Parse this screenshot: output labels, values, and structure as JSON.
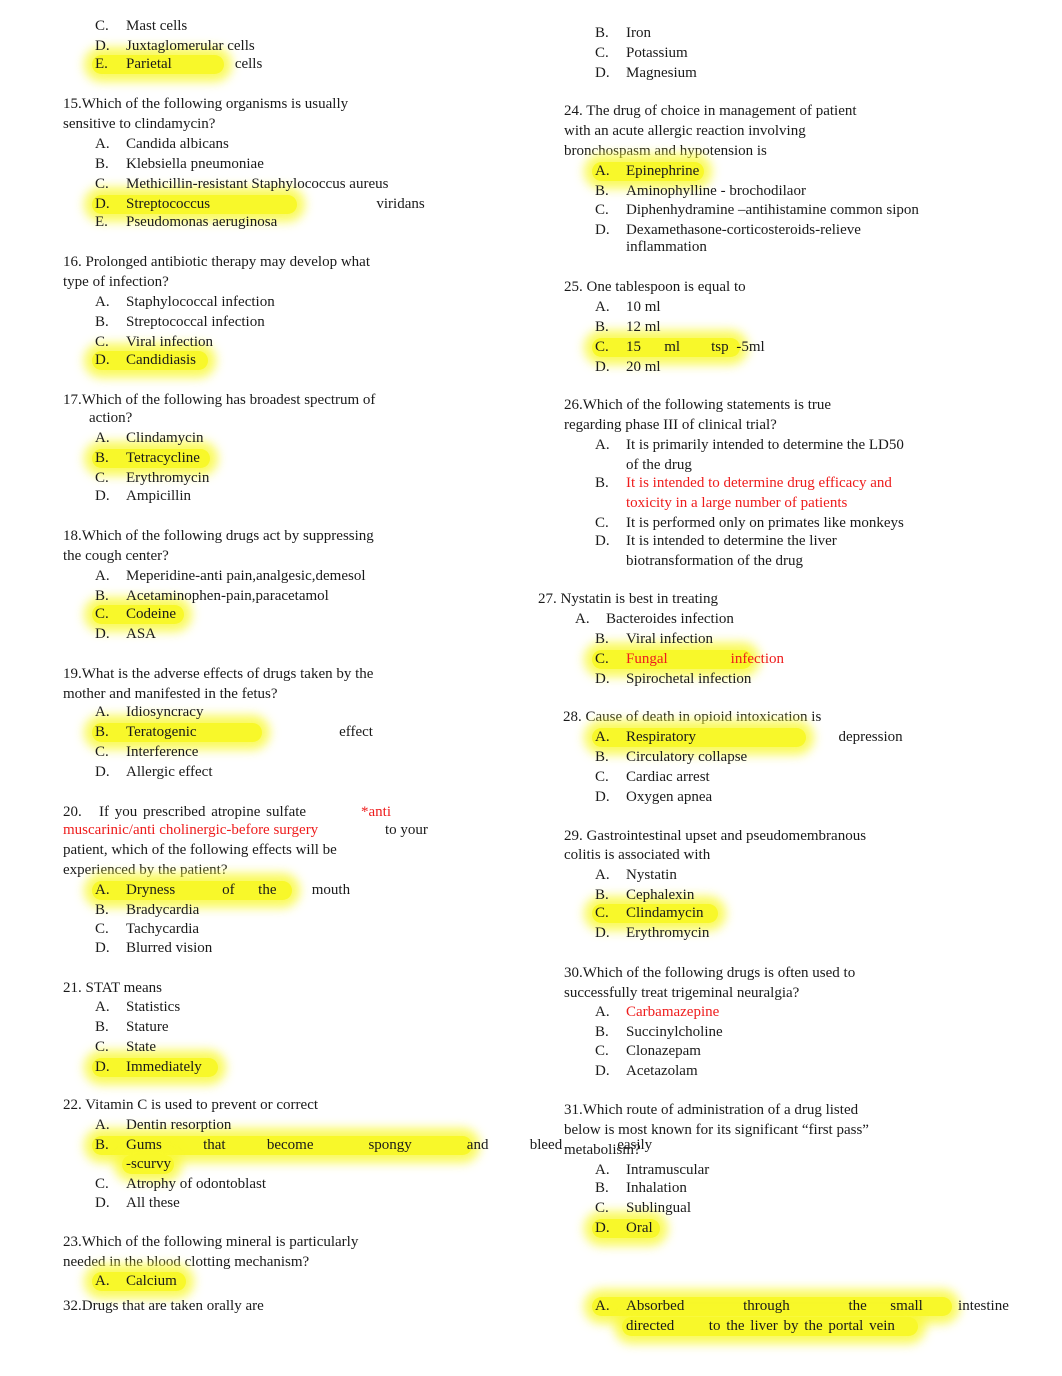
{
  "colors": {
    "highlight": "#f8f82a",
    "answer_red": "#ee1c1c",
    "text": "#1a1a1a"
  },
  "left": {
    "q14_tail": {
      "options": [
        {
          "letter": "C.",
          "text": "Mast cells"
        },
        {
          "letter": "D.",
          "text": "Juxtaglomerular cells"
        },
        {
          "letter": "E.",
          "text": "Parietal    cells",
          "highlighted": true
        }
      ]
    },
    "q15": {
      "question": [
        "15.Which of the following organisms is usually",
        "sensitive to clindamycin?"
      ],
      "options": [
        {
          "letter": "A.",
          "text": "Candida albicans"
        },
        {
          "letter": "B.",
          "text": "Klebsiella pneumoniae"
        },
        {
          "letter": "C.",
          "text": "Methicillin-resistant Staphylococcus aureus"
        },
        {
          "letter": "D.",
          "text": "Streptococcus       viridans",
          "highlighted": true
        },
        {
          "letter": "E.",
          "text": "Pseudomonas aeruginosa"
        }
      ]
    },
    "q16": {
      "question": [
        "16. Prolonged antibiotic therapy may develop what",
        "type of infection?"
      ],
      "options": [
        {
          "letter": "A.",
          "text": "Staphylococcal infection"
        },
        {
          "letter": "B.",
          "text": "Streptococcal infection"
        },
        {
          "letter": "C.",
          "text": "Viral infection"
        },
        {
          "letter": "D.",
          "text": "Candidiasis",
          "highlighted": true
        }
      ]
    },
    "q17": {
      "question": [
        "17.Which of the following has broadest spectrum of",
        "action?"
      ],
      "options": [
        {
          "letter": "A.",
          "text": "Clindamycin"
        },
        {
          "letter": "B.",
          "text": "Tetracycline",
          "highlighted": true
        },
        {
          "letter": "C.",
          "text": "Erythromycin"
        },
        {
          "letter": "D.",
          "text": "Ampicillin"
        }
      ]
    },
    "q18": {
      "question": [
        "18.Which of the following drugs act by suppressing",
        "the cough center?"
      ],
      "options": [
        {
          "letter": "A.",
          "text": "Meperidine-anti pain,analgesic,demesol"
        },
        {
          "letter": "B.",
          "text": "Acetaminophen-pain,paracetamol"
        },
        {
          "letter": "C.",
          "text": "Codeine",
          "highlighted": true
        },
        {
          "letter": "D.",
          "text": "ASA"
        }
      ]
    },
    "q19": {
      "question": [
        "19.What is the adverse effects of drugs taken by the",
        "mother and manifested in the fetus?"
      ],
      "options": [
        {
          "letter": "A.",
          "text": "Idiosyncracy"
        },
        {
          "letter": "B.",
          "text": "Teratogenic      effect",
          "highlighted": true
        },
        {
          "letter": "C.",
          "text": "Interference"
        },
        {
          "letter": "D.",
          "text": "Allergic effect"
        }
      ]
    },
    "q20": {
      "question_start": "20.   If you prescribed atropine sulfate",
      "note_1": "*anti",
      "note_2": "muscarinic/anti cholinergic-before surgery",
      "question_cont": "to your",
      "question_rest": [
        "patient, which of the following effects will be",
        "experienced by the patient?"
      ],
      "options": [
        {
          "letter": "A.",
          "text": "Dryness    of  the   mouth",
          "highlighted": true
        },
        {
          "letter": "B.",
          "text": "Bradycardia"
        },
        {
          "letter": "C.",
          "text": "Tachycardia"
        },
        {
          "letter": "D.",
          "text": "Blurred vision"
        }
      ]
    },
    "q21": {
      "question": [
        "21. STAT means"
      ],
      "options": [
        {
          "letter": "A.",
          "text": "Statistics"
        },
        {
          "letter": "B.",
          "text": "Stature"
        },
        {
          "letter": "C.",
          "text": "State"
        },
        {
          "letter": "D.",
          "text": "Immediately",
          "highlighted": true
        }
      ]
    },
    "q22": {
      "question": [
        "22. Vitamin C is used to prevent or correct"
      ],
      "options": [
        {
          "letter": "A.",
          "text": "Dentin resorption"
        },
        {
          "letter": "B.",
          "text": "Gums   that   become    spongy    and   bleed    easily",
          "text2": "-scurvy",
          "highlighted": true
        },
        {
          "letter": "C.",
          "text": "Atrophy of odontoblast"
        },
        {
          "letter": "D.",
          "text": "All these"
        }
      ]
    },
    "q23": {
      "question": [
        "23.Which of the following mineral is particularly",
        "needed in the blood clotting mechanism?"
      ],
      "options": [
        {
          "letter": "A.",
          "text": "Calcium",
          "highlighted": true
        }
      ]
    },
    "q32": {
      "question": [
        "32.Drugs that are taken orally are"
      ]
    }
  },
  "right": {
    "q23_tail": {
      "options": [
        {
          "letter": "B.",
          "text": "Iron"
        },
        {
          "letter": "C.",
          "text": "Potassium"
        },
        {
          "letter": "D.",
          "text": "Magnesium"
        }
      ]
    },
    "q24": {
      "question": [
        "24. The drug of choice in management of patient",
        "with an acute allergic reaction involving",
        "bronchospasm and hypotension is"
      ],
      "options": [
        {
          "letter": "A.",
          "text": "Epinephrine",
          "highlighted": true
        },
        {
          "letter": "B.",
          "text": "Aminophylline - brochodilaor"
        },
        {
          "letter": "C.",
          "text": "Diphenhydramine –antihistamine common sipon"
        },
        {
          "letter": "D.",
          "text": "Dexamethasone-corticosteroids-relieve",
          "text2": "inflammation"
        }
      ]
    },
    "q25": {
      "question": [
        "25. One tablespoon is equal to"
      ],
      "options": [
        {
          "letter": "A.",
          "text": "10 ml"
        },
        {
          "letter": "B.",
          "text": "12 ml"
        },
        {
          "letter": "C.",
          "text": "15   ml    tsp -5ml",
          "highlighted": true
        },
        {
          "letter": "D.",
          "text": "20 ml"
        }
      ]
    },
    "q26": {
      "question": [
        "26.Which of the following statements is true",
        "regarding phase III of clinical trial?"
      ],
      "options": [
        {
          "letter": "A.",
          "text": "It is primarily intended to determine the LD50",
          "text2": "of the drug"
        },
        {
          "letter": "B.",
          "text": "It is intended to determine drug efficacy and",
          "text2": "toxicity in a large number of patients",
          "red": true
        },
        {
          "letter": "C.",
          "text": "It is performed only on primates like monkeys"
        },
        {
          "letter": "D.",
          "text": "It is intended to determine the liver",
          "text2": "biotransformation of the drug"
        }
      ]
    },
    "q27": {
      "question": [
        "27. Nystatin is best in treating"
      ],
      "options": [
        {
          "letter": "A.",
          "text": "Bacteroides infection"
        },
        {
          "letter": "B.",
          "text": "Viral infection"
        },
        {
          "letter": "C.",
          "text": "Fungal    infection",
          "highlighted": true,
          "red": true
        },
        {
          "letter": "D.",
          "text": "Spirochetal infection"
        }
      ]
    },
    "q28": {
      "question": [
        "28. Cause of death in opioid intoxication is"
      ],
      "options": [
        {
          "letter": "A.",
          "text": "Respiratory      depression",
          "highlighted": true
        },
        {
          "letter": "B.",
          "text": "Circulatory collapse"
        },
        {
          "letter": "C.",
          "text": "Cardiac arrest"
        },
        {
          "letter": "D.",
          "text": "Oxygen apnea"
        }
      ]
    },
    "q29": {
      "question": [
        "29. Gastrointestinal upset and pseudomembranous",
        "colitis is associated with"
      ],
      "options": [
        {
          "letter": "A.",
          "text": "Nystatin"
        },
        {
          "letter": "B.",
          "text": "Cephalexin"
        },
        {
          "letter": "C.",
          "text": "Clindamycin",
          "highlighted": true
        },
        {
          "letter": "D.",
          "text": "Erythromycin"
        }
      ]
    },
    "q30": {
      "question": [
        "30.Which of the following drugs is often used to",
        "successfully treat trigeminal neuralgia?"
      ],
      "options": [
        {
          "letter": "A.",
          "text": "Carbamazepine",
          "red": true
        },
        {
          "letter": "B.",
          "text": "Succinylcholine"
        },
        {
          "letter": "C.",
          "text": "Clonazepam"
        },
        {
          "letter": "D.",
          "text": "Acetazolam"
        }
      ]
    },
    "q31": {
      "question": [
        "31.Which route of administration of a drug listed",
        "below is most known for its significant “first pass”",
        "metabolism?"
      ],
      "options": [
        {
          "letter": "A.",
          "text": "Intramuscular"
        },
        {
          "letter": "B.",
          "text": "Inhalation"
        },
        {
          "letter": "C.",
          "text": "Sublingual"
        },
        {
          "letter": "D.",
          "text": "Oral",
          "highlighted": true
        }
      ]
    },
    "q32_answer": {
      "options": [
        {
          "letter": "A.",
          "text": "Absorbed     through     the  small   intestine     and",
          "text2": "directed      to the liver by the portal vein",
          "highlighted": true
        }
      ]
    }
  }
}
